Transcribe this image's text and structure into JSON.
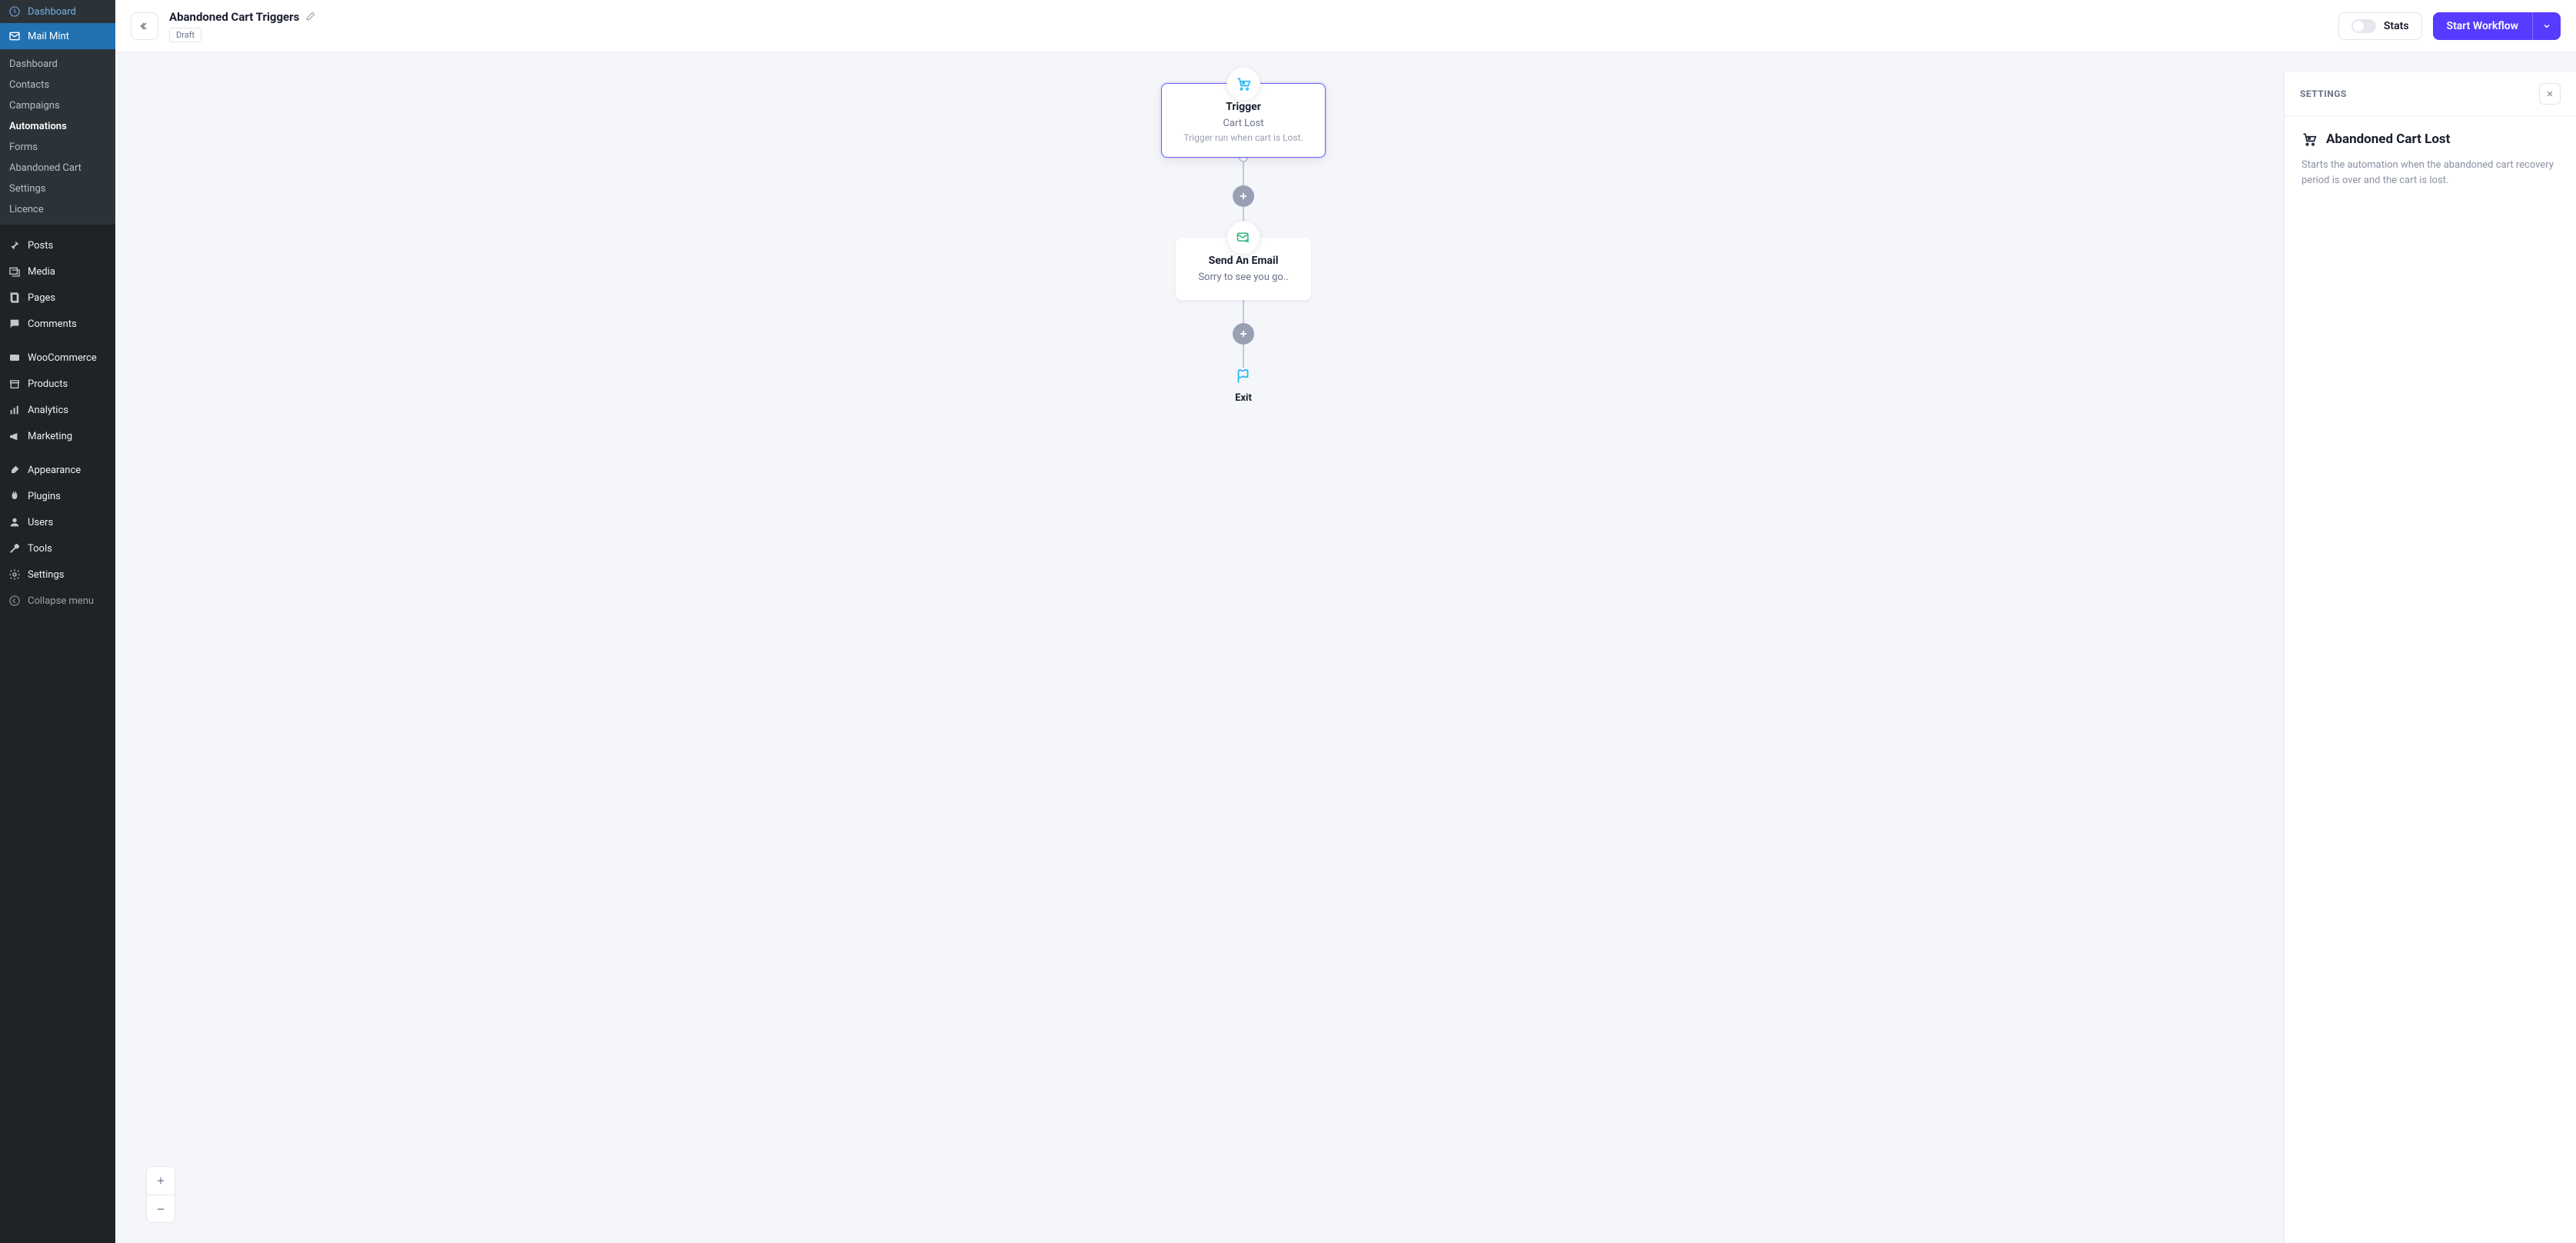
{
  "sidebar": {
    "dashboard": "Dashboard",
    "mailmint": "Mail Mint",
    "sub": {
      "dashboard": "Dashboard",
      "contacts": "Contacts",
      "campaigns": "Campaigns",
      "automations": "Automations",
      "forms": "Forms",
      "abandoned_cart": "Abandoned Cart",
      "settings": "Settings",
      "licence": "Licence"
    },
    "posts": "Posts",
    "media": "Media",
    "pages": "Pages",
    "comments": "Comments",
    "woocommerce": "WooCommerce",
    "products": "Products",
    "analytics": "Analytics",
    "marketing": "Marketing",
    "appearance": "Appearance",
    "plugins": "Plugins",
    "users": "Users",
    "tools": "Tools",
    "settings2": "Settings",
    "collapse": "Collapse menu"
  },
  "header": {
    "title": "Abandoned Cart Triggers",
    "status": "Draft",
    "stats": "Stats",
    "start": "Start Workflow"
  },
  "flow": {
    "trigger": {
      "title": "Trigger",
      "sub": "Cart Lost",
      "desc": "Trigger run when cart is Lost."
    },
    "email": {
      "title": "Send An Email",
      "sub": "Sorry to see you go.."
    },
    "exit": "Exit"
  },
  "settings": {
    "header": "SETTINGS",
    "title": "Abandoned Cart Lost",
    "desc": "Starts the automation when the abandoned cart recovery period is over and the cart is lost."
  }
}
